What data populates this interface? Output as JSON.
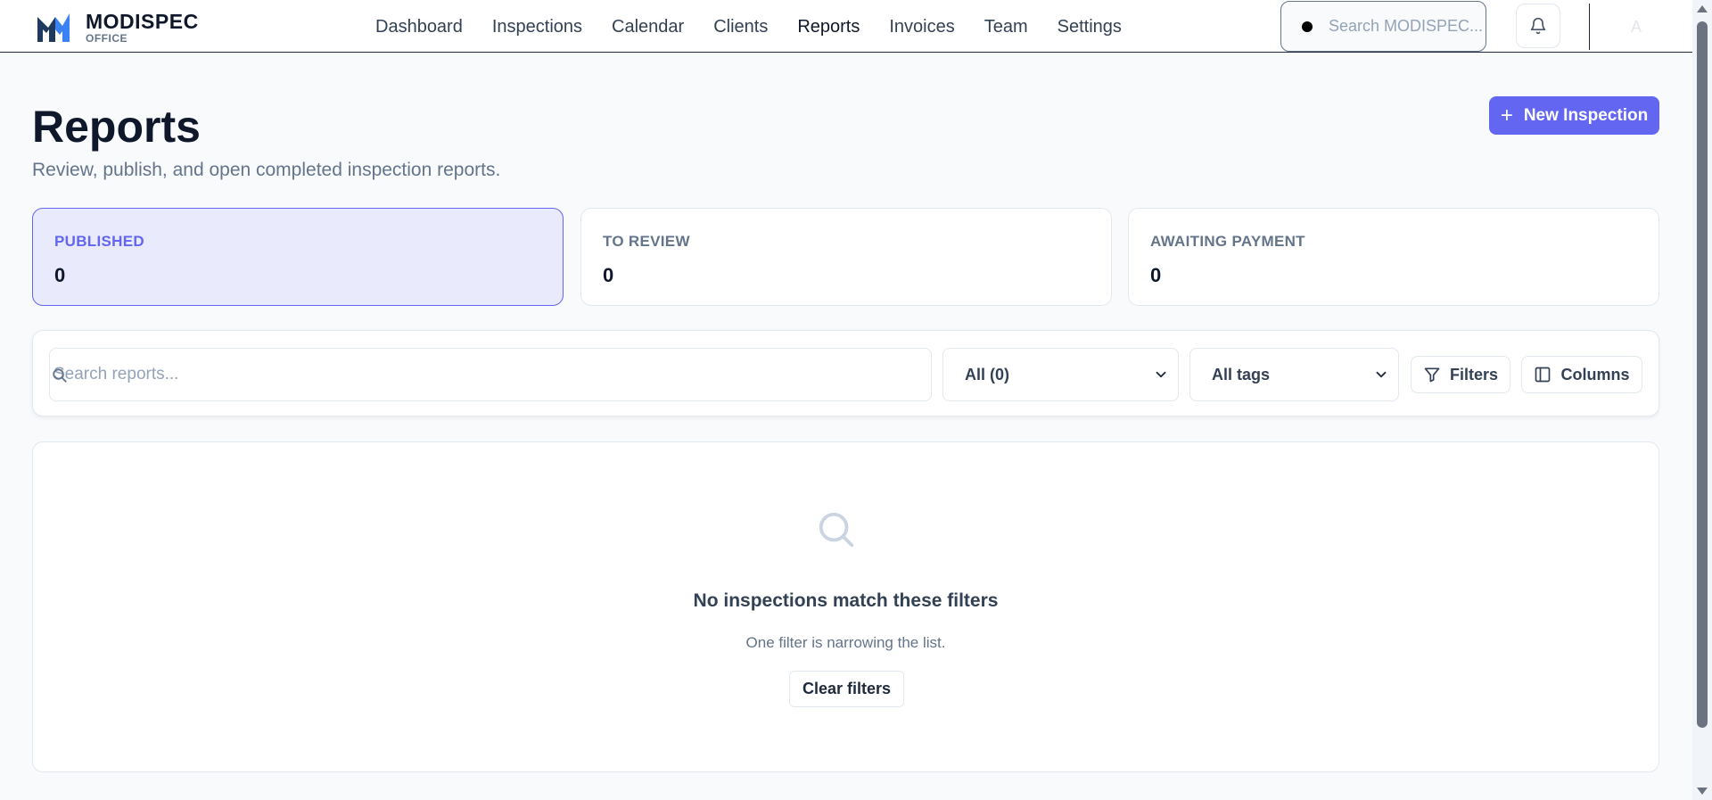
{
  "brand": {
    "name": "MODISPEC",
    "subtitle": "OFFICE",
    "logo_icon": "modispec-logo-icon"
  },
  "nav": {
    "links": [
      {
        "label": "Dashboard",
        "active": false
      },
      {
        "label": "Inspections",
        "active": false
      },
      {
        "label": "Calendar",
        "active": false
      },
      {
        "label": "Clients",
        "active": false
      },
      {
        "label": "Reports",
        "active": true
      },
      {
        "label": "Invoices",
        "active": false
      },
      {
        "label": "Team",
        "active": false
      },
      {
        "label": "Settings",
        "active": false
      }
    ],
    "search_placeholder": "Search MODISPEC...",
    "notifications_icon": "bell-icon",
    "avatar_initial": "A"
  },
  "header": {
    "title": "Reports",
    "subtitle": "Review, publish, and open completed inspection reports.",
    "new_button": "New Inspection",
    "new_button_icon": "plus-icon"
  },
  "stats": [
    {
      "label": "PUBLISHED",
      "value": "0",
      "active": true
    },
    {
      "label": "TO REVIEW",
      "value": "0",
      "active": false
    },
    {
      "label": "AWAITING PAYMENT",
      "value": "0",
      "active": false
    }
  ],
  "filters": {
    "search_placeholder": "Search reports...",
    "status_select": "All (0)",
    "tags_select": "All tags",
    "filters_button": "Filters",
    "columns_button": "Columns"
  },
  "empty_state": {
    "title": "No inspections match these filters",
    "message": "One filter is narrowing the list.",
    "clear_button": "Clear filters"
  },
  "colors": {
    "accent": "#6366f1",
    "active_card_bg": "#e9eafb",
    "text_primary": "#0f172a",
    "text_muted": "#64748b"
  }
}
